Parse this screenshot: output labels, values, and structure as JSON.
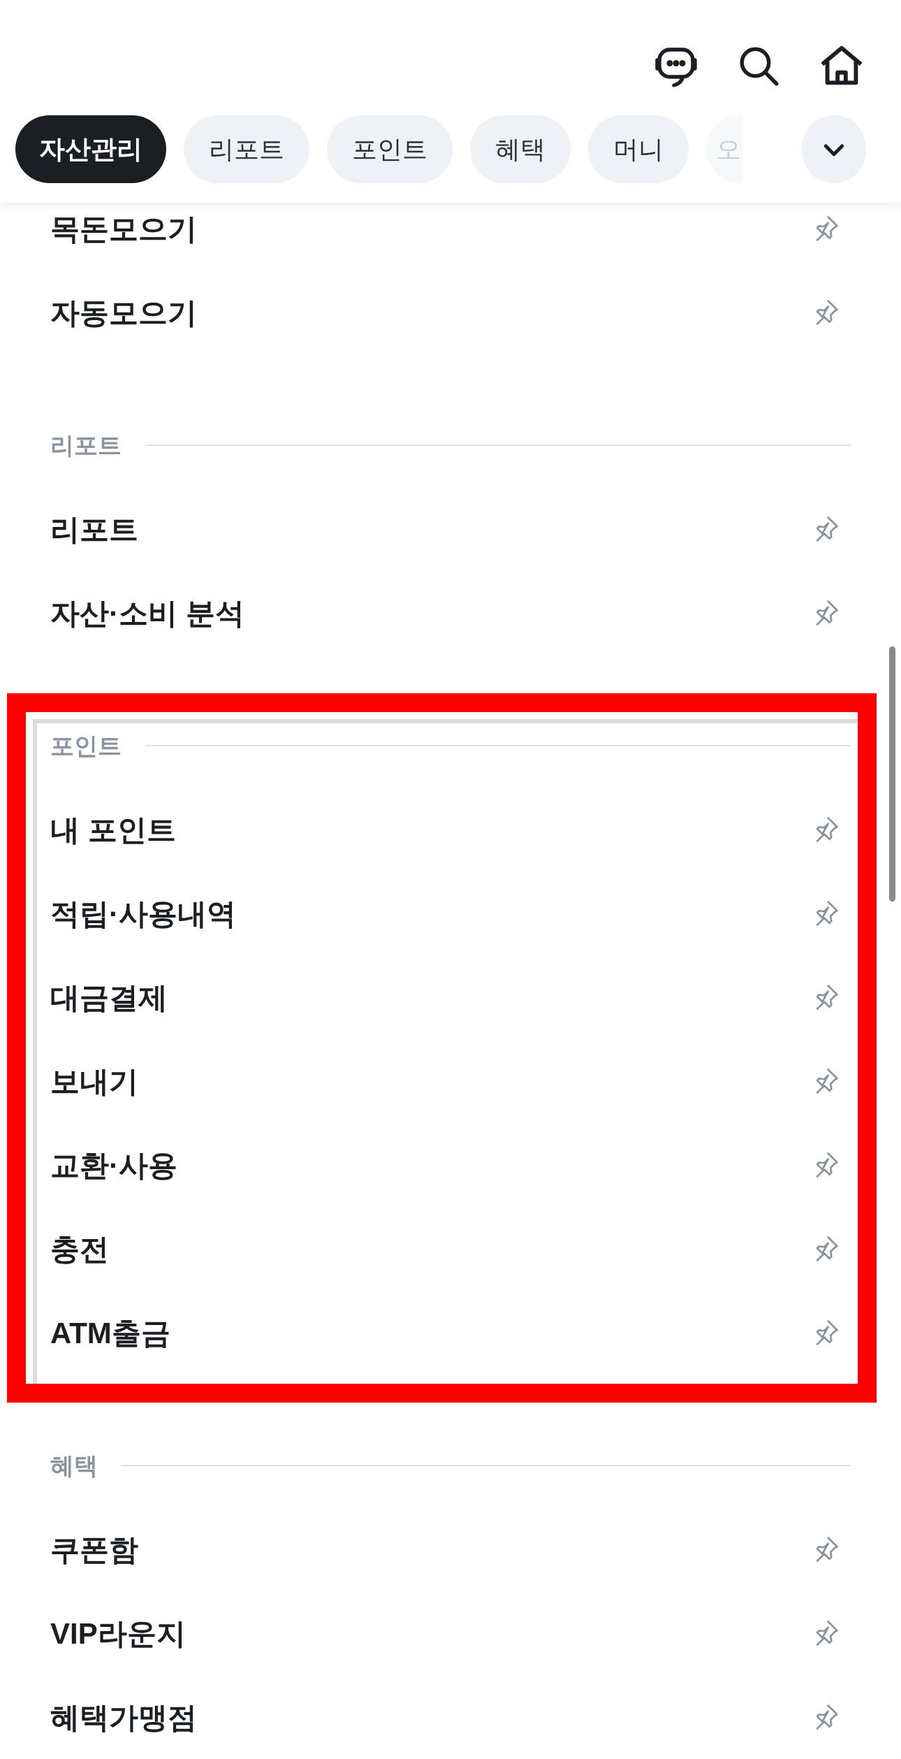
{
  "tabs": [
    {
      "label": "자산관리",
      "selected": true
    },
    {
      "label": "리포트",
      "selected": false
    },
    {
      "label": "포인트",
      "selected": false
    },
    {
      "label": "혜택",
      "selected": false
    },
    {
      "label": "머니",
      "selected": false
    },
    {
      "label": "오",
      "selected": false
    }
  ],
  "sections": [
    {
      "items": [
        {
          "label": "목돈모으기"
        },
        {
          "label": "자동모으기"
        }
      ]
    },
    {
      "title": "리포트",
      "items": [
        {
          "label": "리포트"
        },
        {
          "label": "자산·소비 분석"
        }
      ]
    },
    {
      "title": "포인트",
      "highlighted": true,
      "items": [
        {
          "label": "내 포인트"
        },
        {
          "label": "적립·사용내역"
        },
        {
          "label": "대금결제"
        },
        {
          "label": "보내기"
        },
        {
          "label": "교환·사용"
        },
        {
          "label": "충전"
        },
        {
          "label": "ATM출금"
        }
      ]
    },
    {
      "title": "혜택",
      "items": [
        {
          "label": "쿠폰함"
        },
        {
          "label": "VIP라운지"
        },
        {
          "label": "혜택가맹점"
        }
      ]
    }
  ]
}
